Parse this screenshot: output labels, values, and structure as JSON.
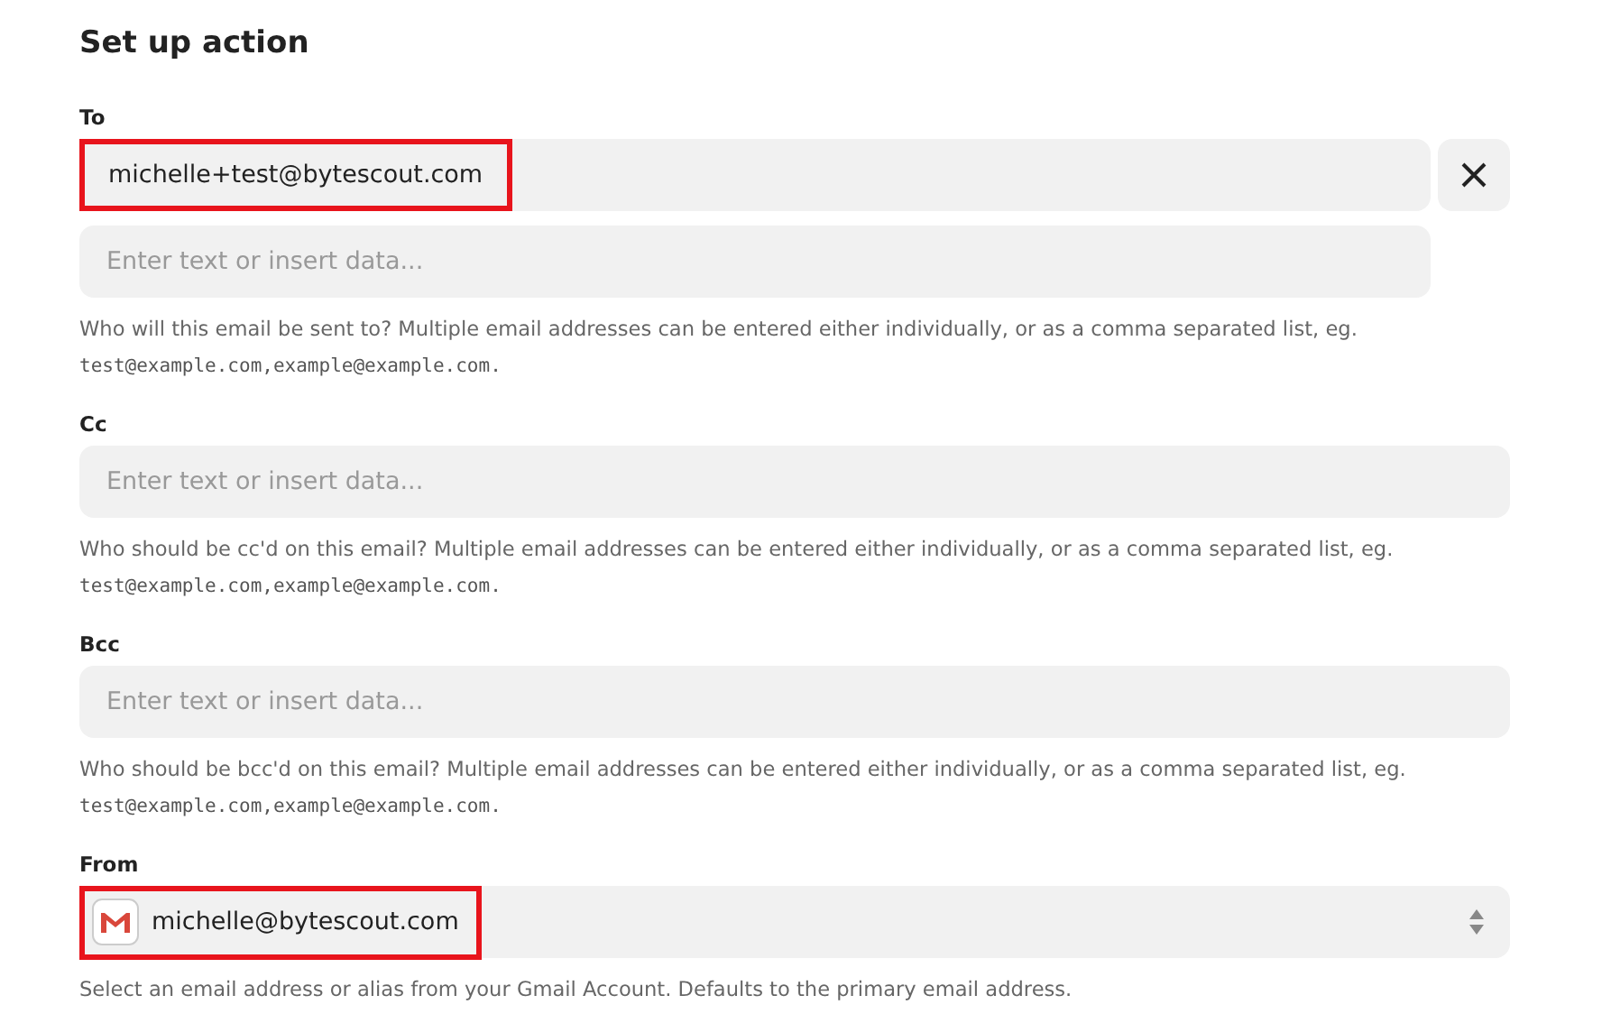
{
  "heading": "Set up action",
  "fields": [
    {
      "kind": "list",
      "label": "To",
      "values": [
        {
          "text": "michelle+test@bytescout.com",
          "highlighted": true
        }
      ],
      "placeholder": "Enter text or insert data...",
      "help": "Who will this email be sent to? Multiple email addresses can be entered either individually, or as a comma separated list, eg.",
      "example": "test@example.com,example@example.com."
    },
    {
      "kind": "text",
      "label": "Cc",
      "placeholder": "Enter text or insert data...",
      "help": "Who should be cc'd on this email? Multiple email addresses can be entered either individually, or as a comma separated list, eg.",
      "example": "test@example.com,example@example.com."
    },
    {
      "kind": "text",
      "label": "Bcc",
      "placeholder": "Enter text or insert data...",
      "help": "Who should be bcc'd on this email? Multiple email addresses can be entered either individually, or as a comma separated list, eg.",
      "example": "test@example.com,example@example.com."
    },
    {
      "kind": "select",
      "label": "From",
      "value": "michelle@bytescout.com",
      "highlighted": true,
      "help": "Select an email address or alias from your Gmail Account. Defaults to the primary email address."
    }
  ]
}
